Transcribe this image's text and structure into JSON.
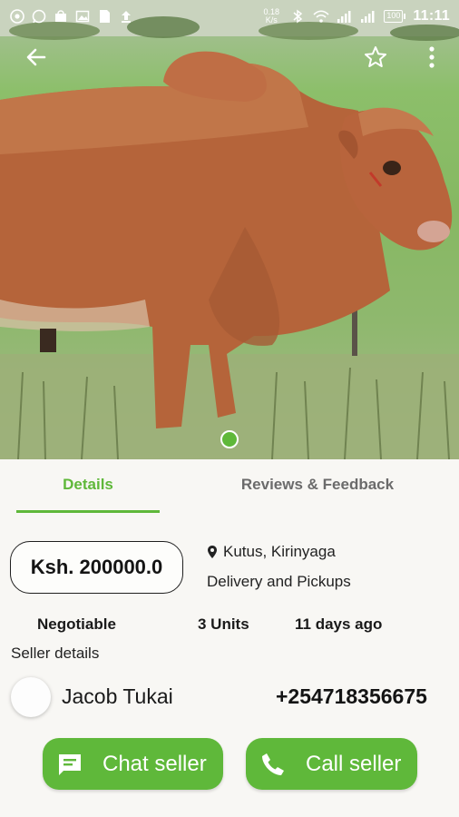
{
  "status_bar": {
    "net_speed_value": "0.18",
    "net_speed_unit": "K/s",
    "battery": "100",
    "time": "11:11",
    "left_icons": [
      "chrome-icon",
      "whatsapp-icon",
      "shop-icon",
      "gallery-icon",
      "sim-icon",
      "upload-icon"
    ],
    "right_icons": [
      "bluetooth-icon",
      "wifi-icon",
      "signal-icon",
      "signal-icon"
    ]
  },
  "toolbar": {
    "back_icon": "arrow-left-icon",
    "favorite_icon": "star-outline-icon",
    "more_icon": "more-vertical-icon"
  },
  "gallery": {
    "image_subject": "brown cow in grass field",
    "page_count": 1,
    "current_page": 1
  },
  "tabs": [
    {
      "label": "Details",
      "active": true
    },
    {
      "label": "Reviews & Feedback",
      "active": false
    }
  ],
  "listing": {
    "price": "Ksh. 200000.0",
    "location": "Kutus, Kirinyaga",
    "delivery": "Delivery and Pickups",
    "negotiable": "Negotiable",
    "units": "3 Units",
    "posted": "11 days ago"
  },
  "seller": {
    "heading": "Seller details",
    "name": "Jacob Tukai",
    "phone": "+254718356675"
  },
  "actions": {
    "chat_label": "Chat seller",
    "call_label": "Call seller"
  },
  "colors": {
    "accent": "#5fb83a",
    "background": "#f8f7f4",
    "inactive_tab": "#6b6b6b"
  }
}
